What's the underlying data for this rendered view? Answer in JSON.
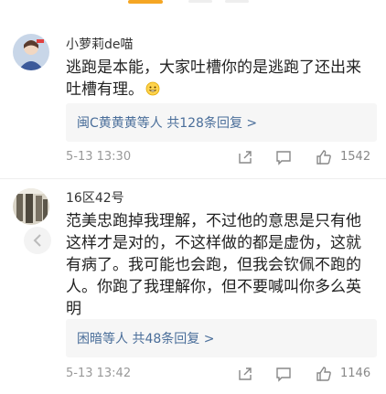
{
  "comments": [
    {
      "username": "小萝莉de喵",
      "text_lines": [
        "逃跑是本能，大家吐槽你的是逃跑了还出来",
        "吐槽有理。"
      ],
      "emoji": "grin-emoji",
      "reply_summary": "闽C黄黄黄等人 共128条回复 >",
      "timestamp": "5-13 13:30",
      "likes": "1542"
    },
    {
      "username": "16区42号",
      "text_lines": [
        "范美忠跑掉我理解，不过他的意思是只有他",
        "这样才是对的，不这样做的都是虚伪，这就",
        "有病了。我可能也会跑，但我会钦佩不跑的",
        "人。你跑了我理解你，但不要喊叫你多么英",
        "明"
      ],
      "reply_summary": "困暗等人 共48条回复 >",
      "timestamp": "5-13 13:42",
      "likes": "1146"
    }
  ],
  "icons": {
    "share": "share-icon",
    "comment": "comment-icon",
    "like": "thumbs-up-icon",
    "back": "chevron-left-icon"
  },
  "colors": {
    "link": "#4a6e9a",
    "accent": "#f5a623",
    "muted": "#999999"
  }
}
